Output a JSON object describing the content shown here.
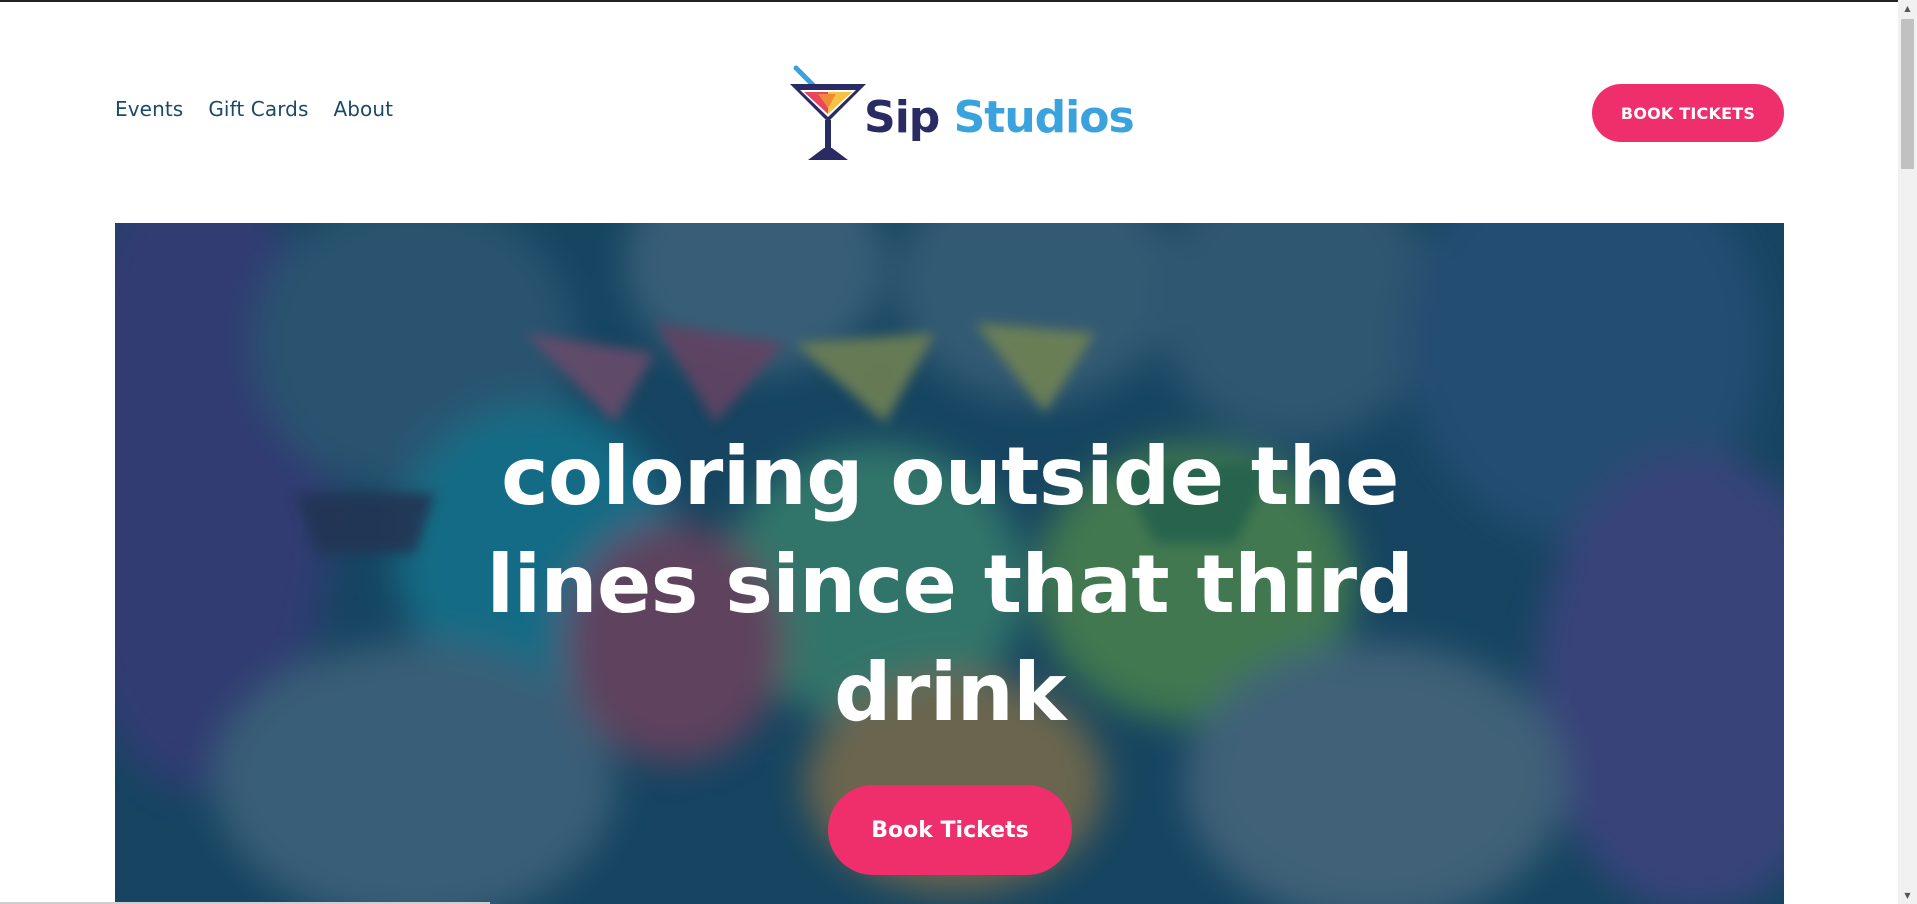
{
  "header": {
    "nav": [
      {
        "label": "Events"
      },
      {
        "label": "Gift Cards"
      },
      {
        "label": "About"
      }
    ],
    "logo": {
      "word1": "Sip",
      "word2": "Studios",
      "icon": "martini-glass-icon"
    },
    "book_button_label": "BOOK TICKETS"
  },
  "hero": {
    "headline": "coloring outside the lines since that third drink",
    "cta_label": "Book Tickets"
  },
  "colors": {
    "accent": "#ee2f6c",
    "nav_text": "#1a4a66",
    "logo_dark": "#2a2b63",
    "logo_light": "#3aa3de",
    "hero_overlay": "#0e3e5c"
  }
}
